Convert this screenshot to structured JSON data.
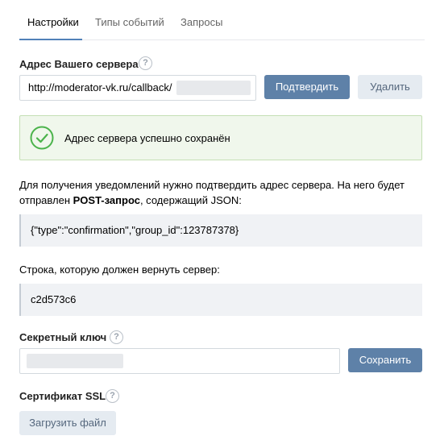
{
  "tabs": [
    {
      "label": "Настройки",
      "active": true
    },
    {
      "label": "Типы событий",
      "active": false
    },
    {
      "label": "Запросы",
      "active": false
    }
  ],
  "server": {
    "label": "Адрес Вашего сервера",
    "help": "?",
    "value": "http://moderator-vk.ru/callback/",
    "confirm_label": "Подтвердить",
    "delete_label": "Удалить"
  },
  "success": {
    "message": "Адрес сервера успешно сохранён",
    "color": "#4bb34b"
  },
  "info": {
    "line1": "Для получения уведомлений нужно подтвердить адрес сервера. На него будет",
    "line2_prefix": "отправлен ",
    "line2_bold": "POST-запрос",
    "line2_suffix": ", содержащий JSON:"
  },
  "json_request": "{\"type\":\"confirmation\",\"group_id\":123787378}",
  "response_label": "Строка, которую должен вернуть сервер:",
  "response_code": "c2d573c6",
  "secret": {
    "label": "Секретный ключ",
    "help": "?",
    "save_label": "Сохранить"
  },
  "ssl": {
    "label": "Сертификат SSL",
    "help": "?",
    "upload_label": "Загрузить файл"
  },
  "colors": {
    "accent": "#5181b8",
    "primary_button": "#5e81a8",
    "secondary_button": "#e5ebf1"
  }
}
